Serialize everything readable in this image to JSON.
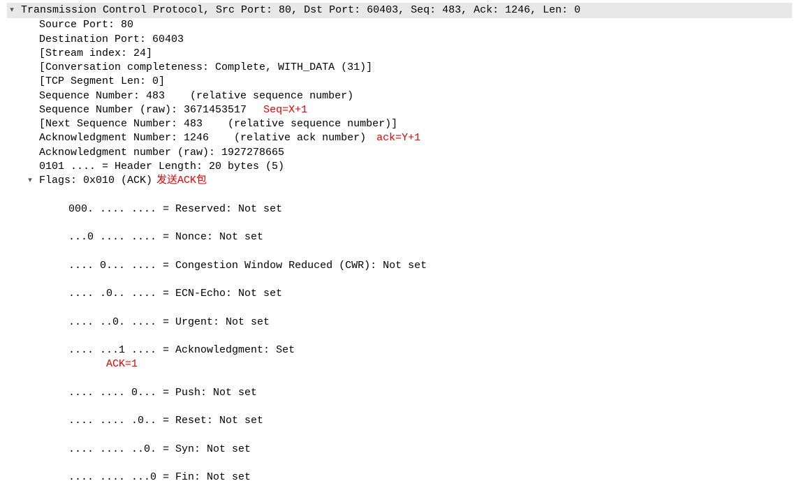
{
  "header": {
    "text": "Transmission Control Protocol, Src Port: 80, Dst Port: 60403, Seq: 483, Ack: 1246, Len: 0"
  },
  "fields": {
    "source_port": "Source Port: 80",
    "dest_port": "Destination Port: 60403",
    "stream_index": "[Stream index: 24]",
    "conv_complete": "[Conversation completeness: Complete, WITH_DATA (31)]",
    "tcp_seg_len": "[TCP Segment Len: 0]",
    "seq_num": "Sequence Number: 483    (relative sequence number)",
    "seq_num_raw": "Sequence Number (raw): 3671453517",
    "seq_annotation": "  Seq=X+1",
    "next_seq": "[Next Sequence Number: 483    (relative sequence number)]",
    "ack_num": "Acknowledgment Number: 1246    (relative ack number)",
    "ack_annotation": " ack=Y+1",
    "ack_num_raw": "Acknowledgment number (raw): 1927278665",
    "header_len": "0101 .... = Header Length: 20 bytes (5)"
  },
  "flags": {
    "header": "Flags: 0x010 (ACK)",
    "header_annotation": " 发送ACK包",
    "reserved": "000. .... .... = Reserved: Not set",
    "nonce": "...0 .... .... = Nonce: Not set",
    "cwr": ".... 0... .... = Congestion Window Reduced (CWR): Not set",
    "ecn": ".... .0.. .... = ECN-Echo: Not set",
    "urgent": ".... ..0. .... = Urgent: Not set",
    "ack": ".... ...1 .... = Acknowledgment: Set",
    "ack_annotation": "      ACK=1",
    "push": ".... .... 0... = Push: Not set",
    "reset": ".... .... .0.. = Reset: Not set",
    "syn": ".... .... ..0. = Syn: Not set",
    "fin": ".... .... ...0 = Fin: Not set"
  }
}
